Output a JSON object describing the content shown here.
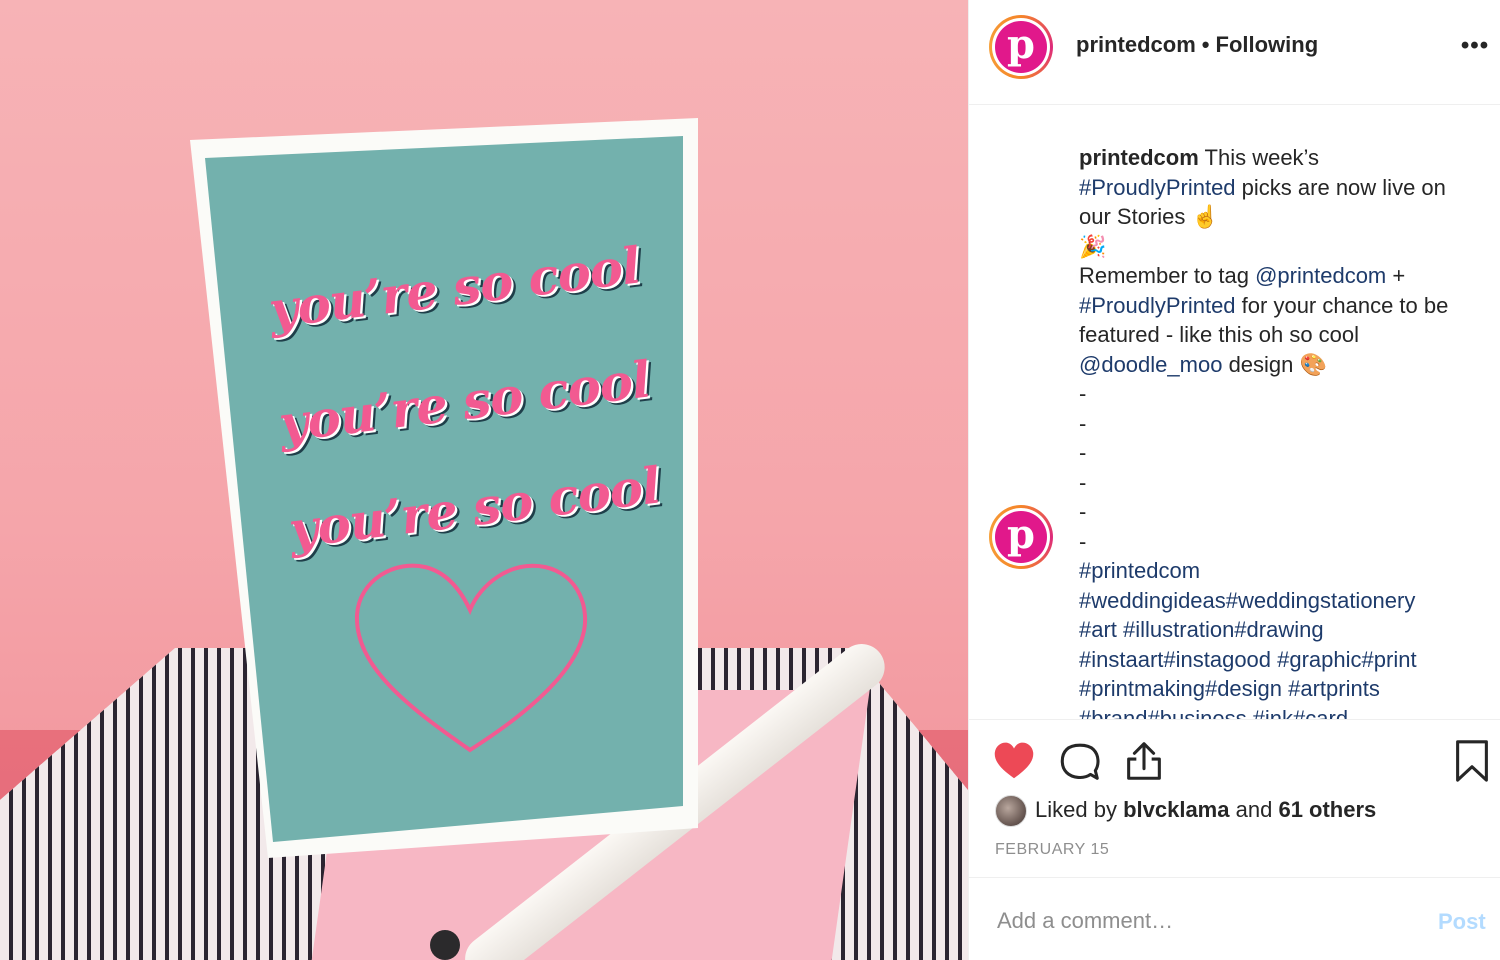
{
  "post": {
    "username": "printedcom",
    "separator": "•",
    "follow_status": "Following",
    "more_icon": "more-horizontal-icon",
    "avatar_letter": "p"
  },
  "photo": {
    "card_text": [
      "you’re so cool",
      "you’re so cool",
      "you’re so cool"
    ]
  },
  "caption": {
    "username": "printedcom",
    "line1": "This week’s",
    "hashtag1": "#ProudlyPrinted",
    "line2": "picks are now live on",
    "line3": "our Stories ☝️",
    "line4": "🎉",
    "line5": "Remember to tag",
    "mention1": "@printedcom",
    "line5b": "+",
    "hashtag2": "#ProudlyPrinted",
    "line6": "for your chance to be",
    "line7": "featured - like this oh so cool",
    "mention2": "@doodle_moo",
    "line8": "design 🎨",
    "dashes": [
      "-",
      "-",
      "-",
      "-",
      "-",
      "-"
    ],
    "hashtag_lines": [
      "#printedcom",
      "#weddingideas#weddingstationery",
      "#art #illustration#drawing",
      "#instaart#instagood #graphic#print",
      "#printmaking#design #artprints",
      "#brand#business #ink#card"
    ]
  },
  "actions": {
    "like_icon": "heart-filled-icon",
    "comment_icon": "comment-icon",
    "share_icon": "share-icon",
    "save_icon": "bookmark-icon",
    "like_color": "#ed4956"
  },
  "likes": {
    "prefix": "Liked by",
    "user": "blvcklama",
    "middle": "and",
    "others": "61 others"
  },
  "date": "FEBRUARY 15",
  "comment": {
    "placeholder": "Add a comment…",
    "post_label": "Post",
    "post_color": "#b3dbff"
  }
}
